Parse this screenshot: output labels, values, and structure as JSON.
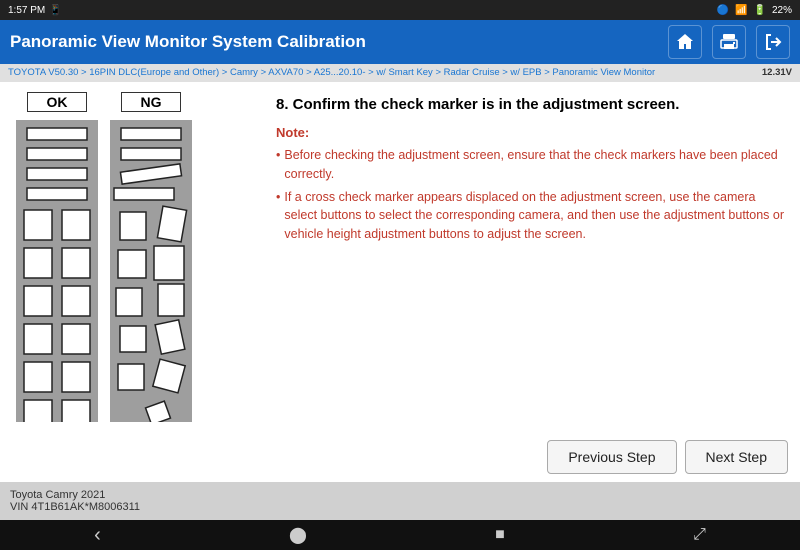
{
  "statusBar": {
    "time": "1:57 PM",
    "battery": "22%",
    "icons": [
      "bluetooth",
      "signal",
      "battery"
    ]
  },
  "header": {
    "title": "Panoramic View Monitor System Calibration",
    "homeIcon": "🏠",
    "printIcon": "🖨",
    "exitIcon": "➡"
  },
  "breadcrumb": {
    "text": "TOYOTA V50.30 > 16PIN DLC(Europe and Other) > Camry > AXVA70 > A25...20.10- > w/ Smart Key > Radar Cruise > w/ EPB > Panoramic View Monitor",
    "right": "12.31V"
  },
  "instruction": {
    "title": "8. Confirm the check marker is in the adjustment screen.",
    "noteLabel": "Note:",
    "bullets": [
      "Before checking the adjustment screen, ensure that the check markers have been placed correctly.",
      "If a cross check marker appears displaced on the adjustment screen, use the camera select buttons to select the corresponding camera, and then use the adjustment buttons or vehicle height adjustment buttons to adjust the screen."
    ]
  },
  "diagrams": {
    "okLabel": "OK",
    "ngLabel": "NG"
  },
  "buttons": {
    "previousStep": "Previous Step",
    "nextStep": "Next Step"
  },
  "footer": {
    "line1": "Toyota Camry 2021",
    "line2": "VIN 4T1B61AK*M8006311"
  },
  "navBar": {
    "back": "‹",
    "home": "⬤",
    "square": "■",
    "resize": "⤢"
  }
}
